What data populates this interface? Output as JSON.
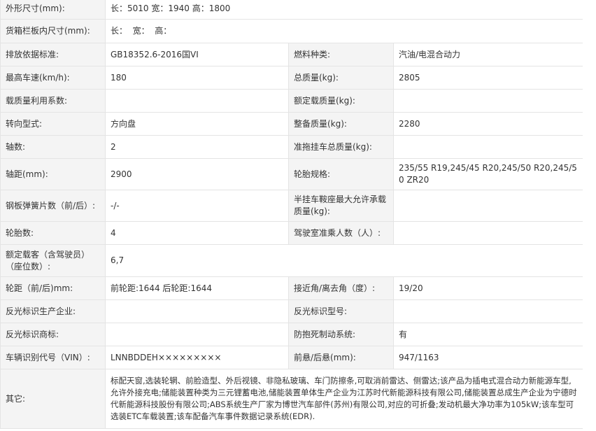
{
  "rows": [
    {
      "l1": "外形尺寸(mm):",
      "v1": "长：5010 宽：1940 高：1800"
    },
    {
      "l1": "货箱栏板内尺寸(mm):",
      "v1": "长：  宽：  高："
    },
    {
      "l1": "排放依据标准:",
      "v1": "GB18352.6-2016国VI",
      "l2": "燃料种类:",
      "v2": "汽油/电混合动力"
    },
    {
      "l1": "最高车速(km/h):",
      "v1": "180",
      "l2": "总质量(kg):",
      "v2": "2805"
    },
    {
      "l1": "载质量利用系数:",
      "v1": "",
      "l2": "额定载质量(kg):",
      "v2": ""
    },
    {
      "l1": "转向型式:",
      "v1": "方向盘",
      "l2": "整备质量(kg):",
      "v2": "2280"
    },
    {
      "l1": "轴数:",
      "v1": "2",
      "l2": "准拖挂车总质量(kg):",
      "v2": ""
    },
    {
      "l1": "轴距(mm):",
      "v1": "2900",
      "l2": "轮胎规格:",
      "v2": "235/55 R19,245/45 R20,245/50 R20,245/50 ZR20"
    },
    {
      "l1": "钢板弹簧片数（前/后）:",
      "v1": "-/-",
      "l2": "半挂车鞍座最大允许承载质量(kg):",
      "v2": ""
    },
    {
      "l1": "轮胎数:",
      "v1": "4",
      "l2": "驾驶室准乘人数（人）:",
      "v2": ""
    },
    {
      "l1": "额定载客（含驾驶员）（座位数）:",
      "v1": "6,7"
    },
    {
      "l1": "轮距（前/后)mm:",
      "v1": "前轮距:1644 后轮距:1644",
      "l2": "接近角/离去角（度）:",
      "v2": "19/20"
    },
    {
      "l1": "反光标识生产企业:",
      "v1": "",
      "l2": "反光标识型号:",
      "v2": ""
    },
    {
      "l1": "反光标识商标:",
      "v1": "",
      "l2": "防抱死制动系统:",
      "v2": "有"
    },
    {
      "l1": "车辆识别代号（VIN）:",
      "v1": "LNNBDDEH×××××××××",
      "l2": "前悬/后悬(mm):",
      "v2": "947/1163"
    },
    {
      "l1": "其它:",
      "v1": "标配天窗,选装轮辋、前脸造型、外后视镜、非隐私玻璃、车门防擦条,可取消前雷达、侧雷达;该产品为插电式混合动力新能源车型,允许外接充电;储能装置种类为三元锂蓄电池,储能装置单体生产企业为江苏时代新能源科技有限公司,储能装置总成生产企业为宁德时代新能源科技股份有限公司;ABS系统生产厂家为博世汽车部件(苏州)有限公司,对应的可折叠;发动机最大净功率为105kW;该车型可选装ETC车载装置;该车配备汽车事件数据记录系统(EDR)."
    }
  ]
}
